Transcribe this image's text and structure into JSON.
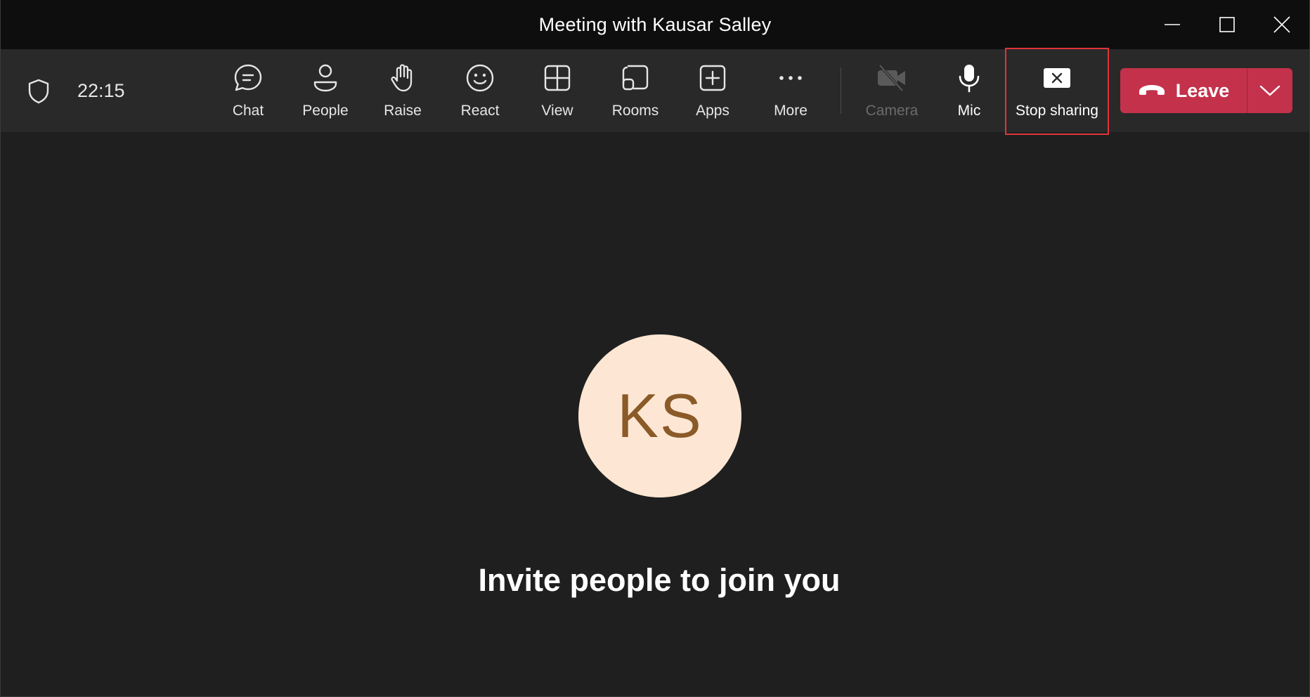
{
  "window": {
    "title": "Meeting with Kausar Salley",
    "controls": {
      "minimize": "minimize-icon",
      "maximize": "maximize-icon",
      "close": "close-icon"
    }
  },
  "toolbar": {
    "timer": "22:15",
    "buttons": [
      {
        "label": "Chat",
        "icon": "chat-icon"
      },
      {
        "label": "People",
        "icon": "people-icon"
      },
      {
        "label": "Raise",
        "icon": "raise-hand-icon"
      },
      {
        "label": "React",
        "icon": "smiley-icon"
      },
      {
        "label": "View",
        "icon": "grid-view-icon"
      },
      {
        "label": "Rooms",
        "icon": "rooms-icon"
      },
      {
        "label": "Apps",
        "icon": "add-app-icon"
      },
      {
        "label": "More",
        "icon": "more-icon"
      },
      {
        "label": "Camera",
        "icon": "camera-off-icon",
        "state": "disabled"
      },
      {
        "label": "Mic",
        "icon": "mic-icon"
      },
      {
        "label": "Stop sharing",
        "icon": "stop-sharing-icon",
        "highlighted": true
      }
    ],
    "leave": {
      "label": "Leave",
      "color": "#c4314b"
    }
  },
  "stage": {
    "avatar_initials": "KS",
    "avatar_bg": "#fde7d4",
    "message": "Invite people to join you"
  },
  "colors": {
    "background": "#1f1f1f",
    "toolbar": "#292929",
    "titlebar": "#0e0e0e",
    "highlight_border": "#e0343a"
  }
}
